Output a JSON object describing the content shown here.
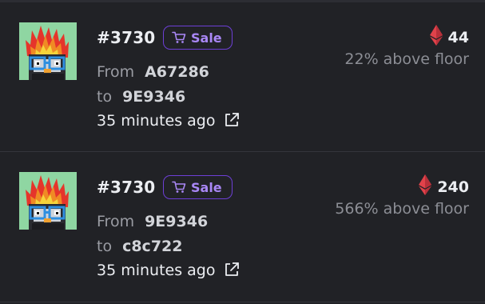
{
  "colors": {
    "background": "#212226",
    "sale_accent": "#a987f5",
    "sale_border": "#6d3fd6",
    "eth_red": "#e0424a",
    "thumb_bg": "#8fd6a2"
  },
  "activities": [
    {
      "token_id": "#3730",
      "badge_label": "Sale",
      "badge_icon": "cart-icon",
      "from_label": "From",
      "from_address": "A67286",
      "to_label": "to",
      "to_address": "9E9346",
      "time": "35 minutes ago",
      "price_icon": "eth-diamond-icon",
      "price": "44",
      "floor_text": "22% above floor"
    },
    {
      "token_id": "#3730",
      "badge_label": "Sale",
      "badge_icon": "cart-icon",
      "from_label": "From",
      "from_address": "9E9346",
      "to_label": "to",
      "to_address": "c8c722",
      "time": "35 minutes ago",
      "price_icon": "eth-diamond-icon",
      "price": "240",
      "floor_text": "566% above floor"
    }
  ]
}
